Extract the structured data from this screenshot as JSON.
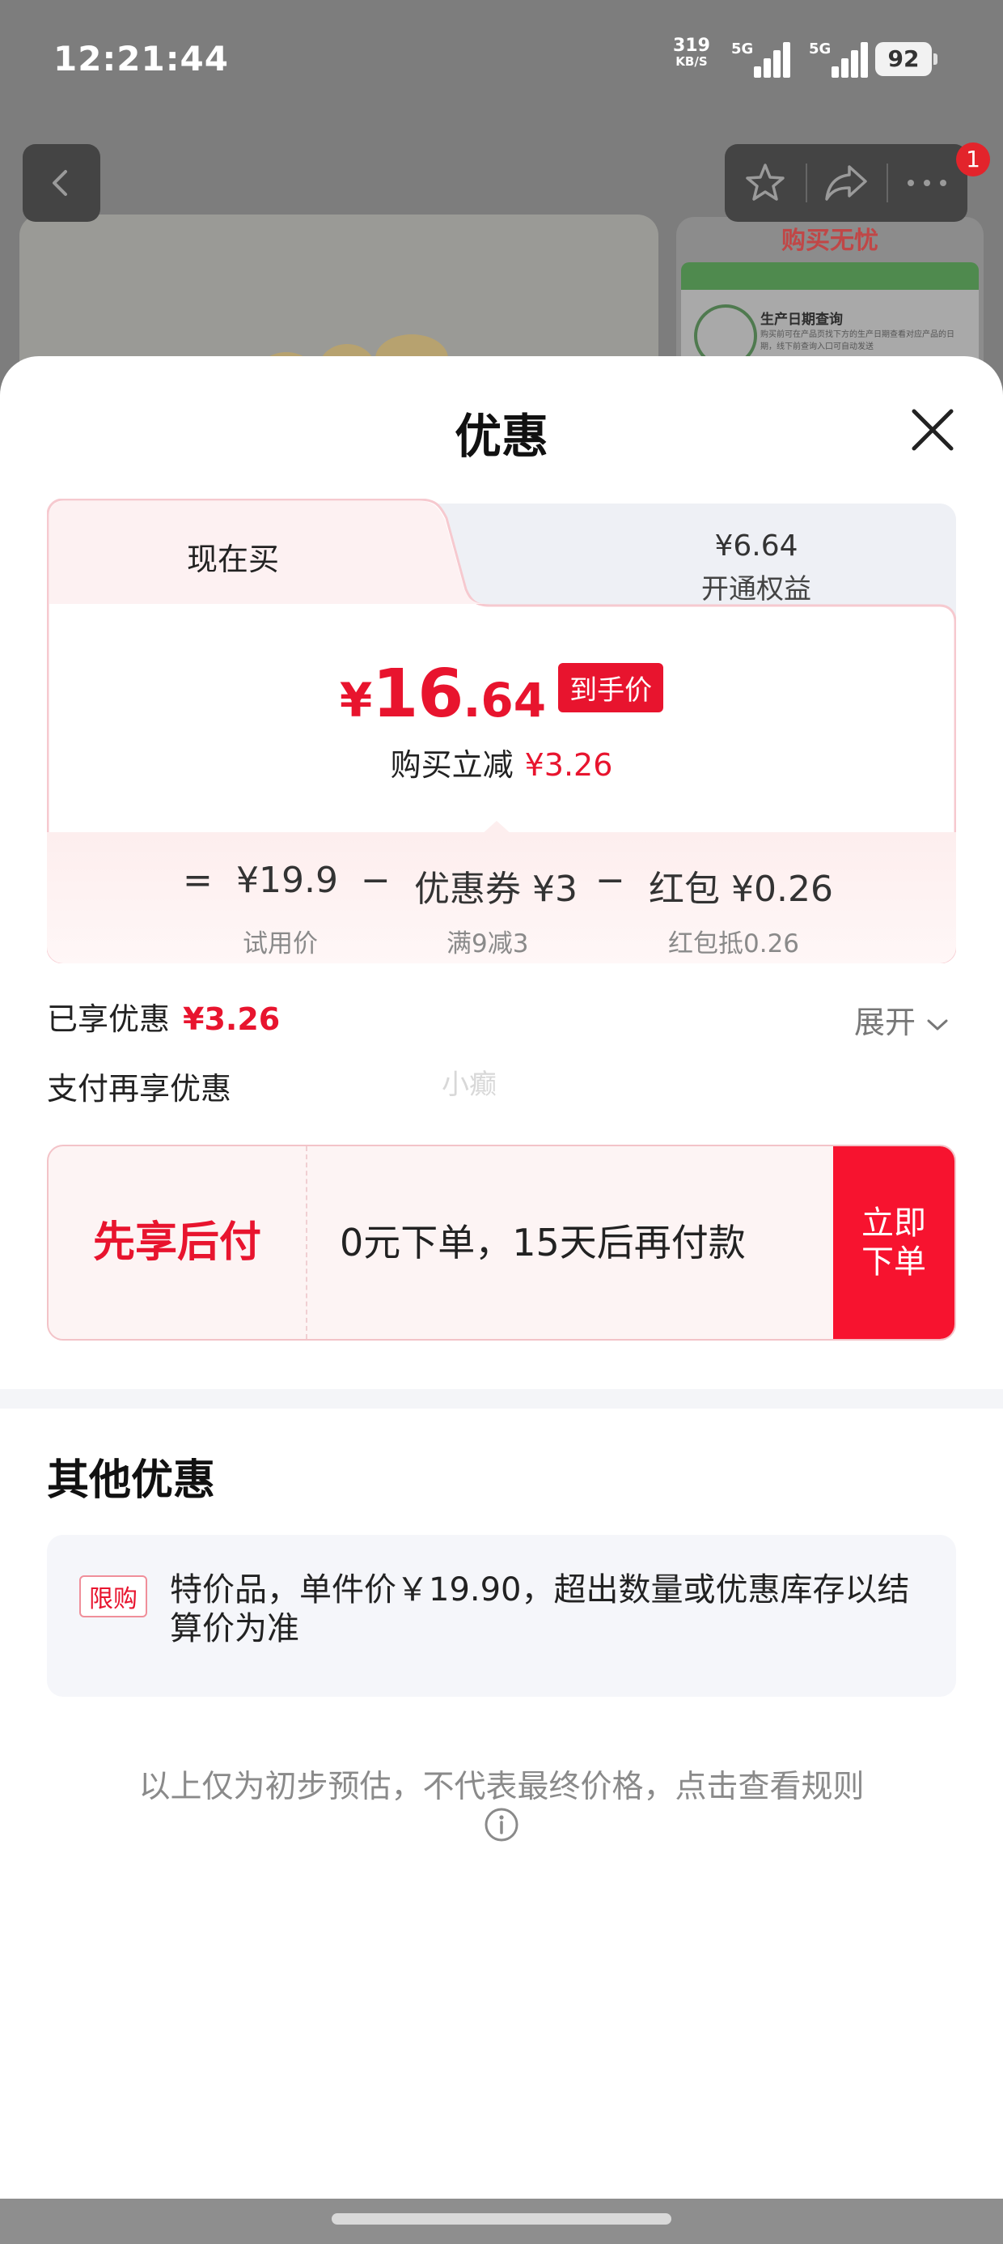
{
  "status_bar": {
    "time": "12:21:44",
    "net_speed": "319",
    "net_unit": "KB/S",
    "sim1_label": "5G",
    "sim2_label": "5G",
    "battery": "92"
  },
  "background_page": {
    "card_header": "购买无忧",
    "card_item_title": "生产日期查询",
    "card_item_desc": "购买前可在产品页找下方的生产日期查看对应产品的日期，线下前查询入口可自动发送",
    "notification_count": "1"
  },
  "sheet": {
    "title": "优惠",
    "tabs": {
      "active_label": "现在买",
      "inactive_price": "¥6.64",
      "inactive_label": "开通权益"
    },
    "final_price": {
      "currency": "¥",
      "integer": "16",
      "decimal": ".64",
      "tag": "到手价"
    },
    "instant_saving": {
      "label": "购买立减",
      "amount": "¥3.26"
    },
    "breakdown": {
      "equals": "=",
      "minus": "−",
      "trial": {
        "value": "¥19.9",
        "caption": "试用价"
      },
      "coupon": {
        "value": "优惠券 ¥3",
        "caption": "满9减3"
      },
      "redpacket": {
        "value": "红包 ¥0.26",
        "caption": "红包抵0.26"
      }
    },
    "enjoyed": {
      "label": "已享优惠",
      "amount": "¥3.26",
      "expand": "展开"
    },
    "pay_more_label": "支付再享优惠",
    "watermark": "小癫",
    "bnpl": {
      "title": "先享后付",
      "desc": "0元下单，15天后再付款",
      "button_line1": "立即",
      "button_line2": "下单"
    },
    "other": {
      "title": "其他优惠",
      "limit_tag": "限购",
      "limit_text": "特价品，单件价￥19.90，超出数量或优惠库存以结算价为准"
    },
    "disclaimer": "以上仅为初步预估，不代表最终价格，点击查看规则"
  },
  "colors": {
    "accent_red": "#e8142e",
    "button_red": "#f7132f",
    "border_pink": "#f3c3c8"
  }
}
